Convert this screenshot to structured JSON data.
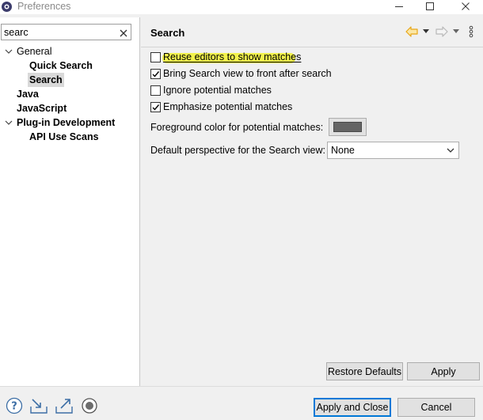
{
  "window": {
    "title": "Preferences"
  },
  "filter": {
    "value": "searc"
  },
  "tree": {
    "items": [
      {
        "label": "General",
        "expanded": true
      },
      {
        "label": "Quick Search"
      },
      {
        "label": "Search",
        "selected": true
      },
      {
        "label": "Java"
      },
      {
        "label": "JavaScript"
      },
      {
        "label": "Plug-in Development",
        "expanded": true
      },
      {
        "label": "API Use Scans"
      }
    ]
  },
  "page": {
    "title": "Search",
    "checkboxes": [
      {
        "label": "Reuse editors to show matches",
        "checked": false,
        "highlighted": true
      },
      {
        "label": "Bring Search view to front after search",
        "checked": true
      },
      {
        "label": "Ignore potential matches",
        "checked": false
      },
      {
        "label": "Emphasize potential matches",
        "checked": true
      }
    ],
    "foreground_label": "Foreground color for potential matches:",
    "foreground_color": "#646464",
    "perspective_label": "Default perspective for the Search view:",
    "perspective_value": "None",
    "restore_defaults_label": "Restore Defaults",
    "apply_label": "Apply"
  },
  "footer": {
    "apply_close_label": "Apply and Close",
    "cancel_label": "Cancel",
    "icons": [
      "help-icon",
      "import-icon",
      "export-icon",
      "record-icon"
    ]
  },
  "colors": {
    "highlight": "#f2f23a",
    "nav_back_arrow": "#e8a617",
    "default_button_border": "#0078d7"
  }
}
